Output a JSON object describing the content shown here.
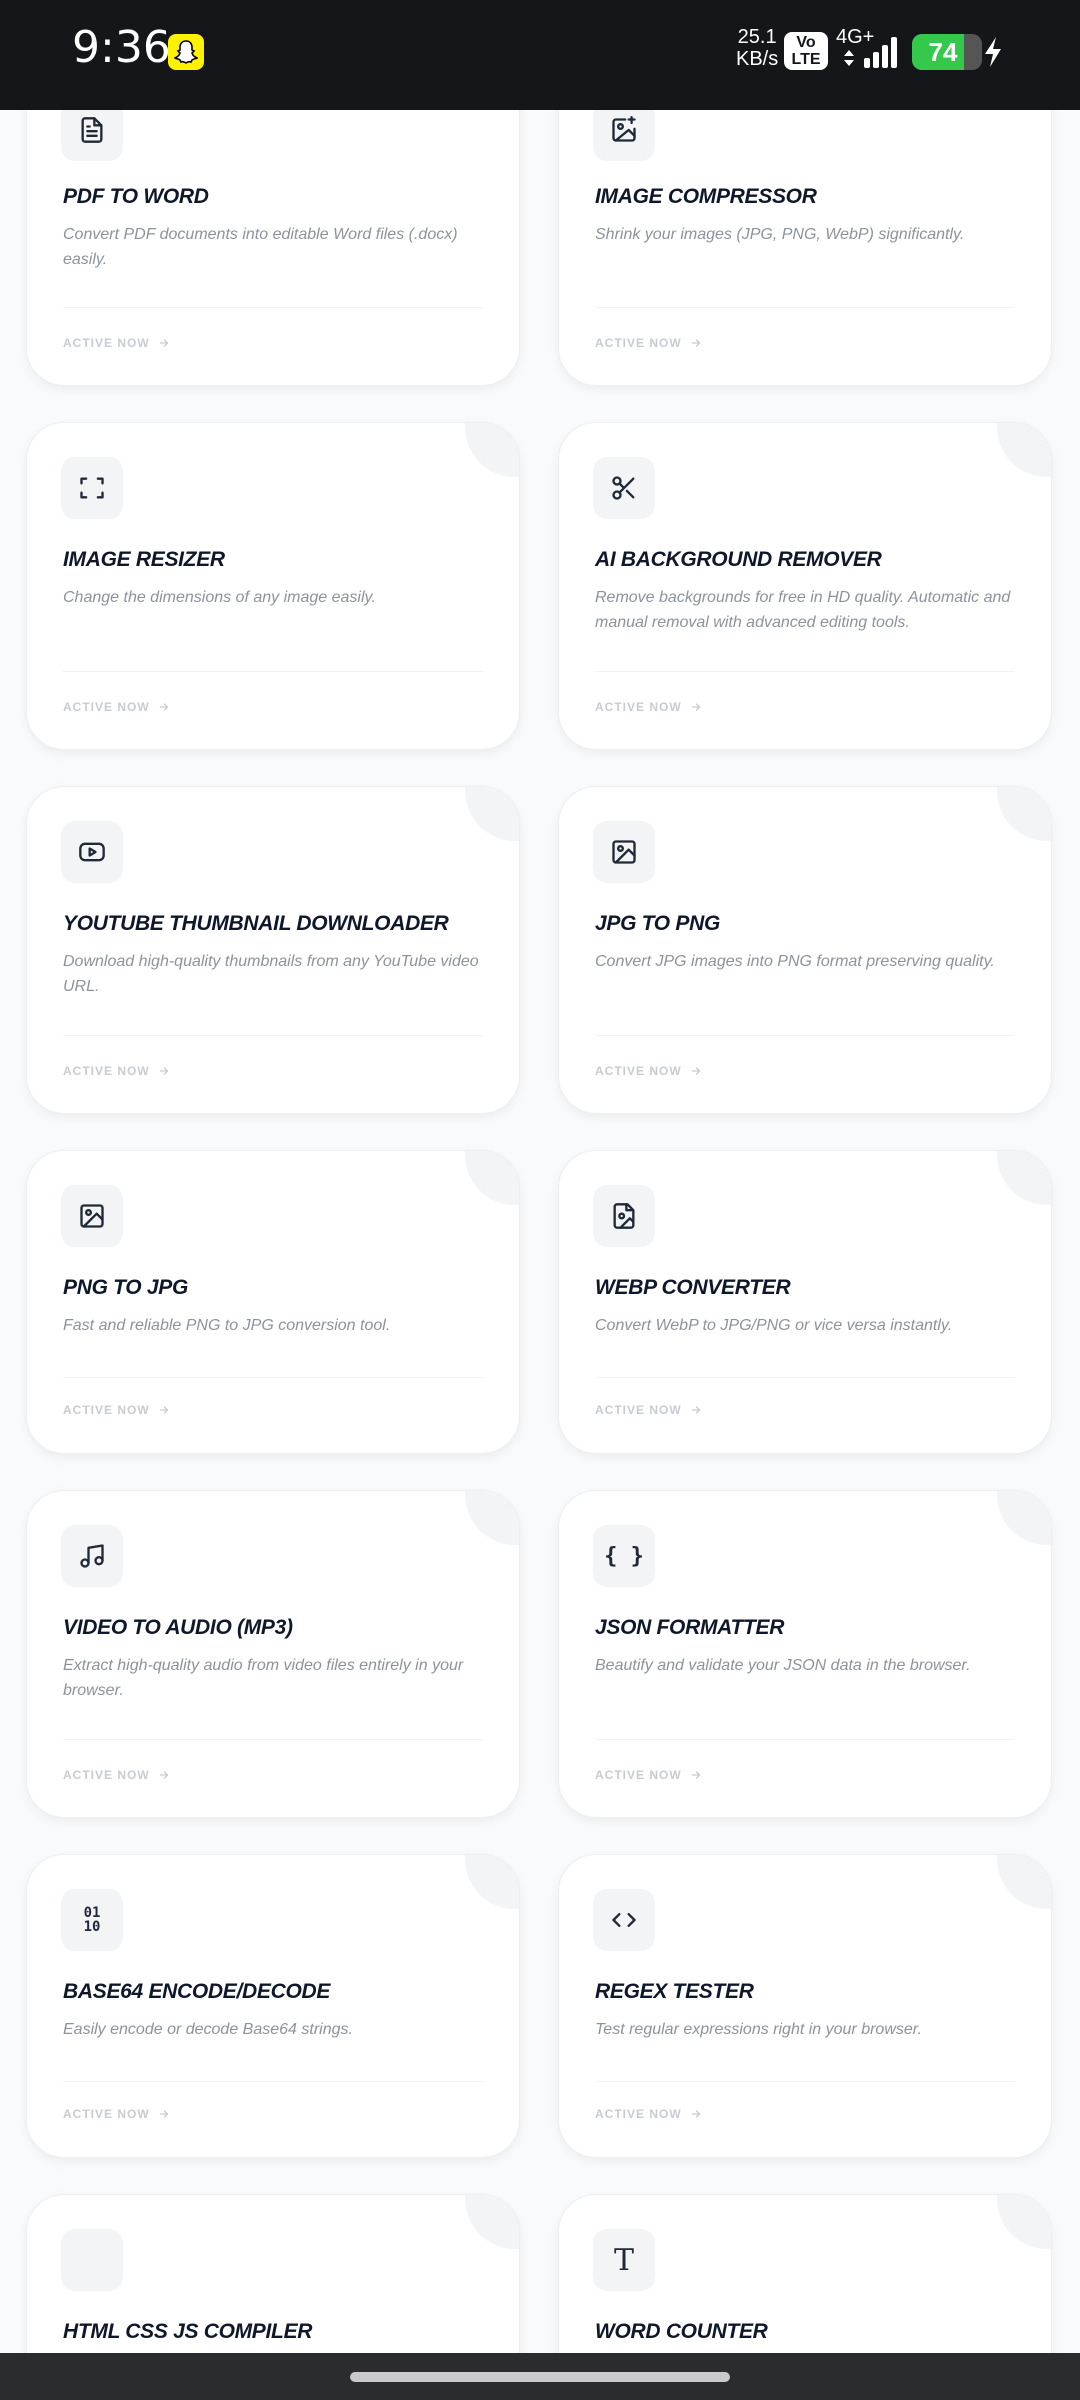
{
  "status_bar": {
    "time": "9:36",
    "speed_value": "25.1",
    "speed_unit": "KB/s",
    "volte_top": "Vo",
    "volte_bottom": "LTE",
    "network": "4G+",
    "battery": "74",
    "battery_level": 0.74
  },
  "tools": [
    {
      "title": "PDF TO WORD",
      "description": "Convert PDF documents into editable Word files (.docx) easily.",
      "status": "ACTIVE NOW",
      "icon": "document-icon"
    },
    {
      "title": "IMAGE COMPRESSOR",
      "description": "Shrink your images (JPG, PNG, WebP) significantly.",
      "status": "ACTIVE NOW",
      "icon": "image-edit-icon"
    },
    {
      "title": "IMAGE RESIZER",
      "description": "Change the dimensions of any image easily.",
      "status": "ACTIVE NOW",
      "icon": "resize-icon"
    },
    {
      "title": "AI BACKGROUND REMOVER",
      "description": "Remove backgrounds for free in HD quality. Automatic and manual removal with advanced editing tools.",
      "status": "ACTIVE NOW",
      "icon": "scissors-icon"
    },
    {
      "title": "YOUTUBE THUMBNAIL DOWNLOADER",
      "description": "Download high-quality thumbnails from any YouTube video URL.",
      "status": "ACTIVE NOW",
      "icon": "youtube-icon"
    },
    {
      "title": "JPG TO PNG",
      "description": "Convert JPG images into PNG format preserving quality.",
      "status": "ACTIVE NOW",
      "icon": "image-icon"
    },
    {
      "title": "PNG TO JPG",
      "description": "Fast and reliable PNG to JPG conversion tool.",
      "status": "ACTIVE NOW",
      "icon": "image-icon"
    },
    {
      "title": "WEBP CONVERTER",
      "description": "Convert WebP to JPG/PNG or vice versa instantly.",
      "status": "ACTIVE NOW",
      "icon": "file-image-icon"
    },
    {
      "title": "VIDEO TO AUDIO (MP3)",
      "description": "Extract high-quality audio from video files entirely in your browser.",
      "status": "ACTIVE NOW",
      "icon": "music-icon"
    },
    {
      "title": "JSON FORMATTER",
      "description": "Beautify and validate your JSON data in the browser.",
      "status": "ACTIVE NOW",
      "icon": "braces-icon",
      "glyph": "{ }"
    },
    {
      "title": "BASE64 ENCODE/DECODE",
      "description": "Easily encode or decode Base64 strings.",
      "status": "ACTIVE NOW",
      "icon": "binary-icon",
      "glyph_top": "01",
      "glyph_bottom": "10"
    },
    {
      "title": "REGEX TESTER",
      "description": "Test regular expressions right in your browser.",
      "status": "ACTIVE NOW",
      "icon": "code-icon"
    },
    {
      "title": "HTML CSS JS COMPILER",
      "description": "",
      "status": "",
      "icon": "blank-icon"
    },
    {
      "title": "WORD COUNTER",
      "description": "",
      "status": "",
      "icon": "type-icon",
      "glyph": "T"
    }
  ]
}
